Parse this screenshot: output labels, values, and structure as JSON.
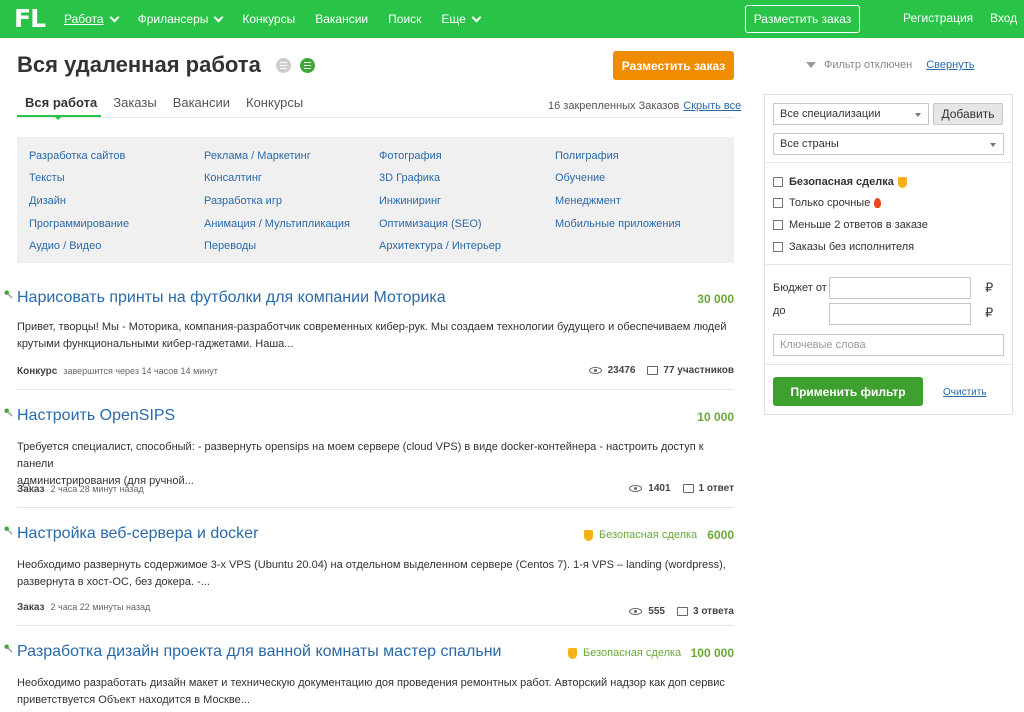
{
  "header": {
    "logo": "FL",
    "nav": [
      {
        "label": "Работа",
        "dropdown": true,
        "active": true
      },
      {
        "label": "Фрилансеры",
        "dropdown": true
      },
      {
        "label": "Конкурсы"
      },
      {
        "label": "Вакансии"
      },
      {
        "label": "Поиск"
      },
      {
        "label": "Еще",
        "dropdown": true
      }
    ],
    "post_order": "Разместить заказ",
    "register": "Регистрация",
    "login": "Вход"
  },
  "page": {
    "title": "Вся удаленная работа",
    "post_order_button": "Разместить заказ",
    "tabs": [
      "Вся работа",
      "Заказы",
      "Вакансии",
      "Конкурсы"
    ],
    "pinned_text": "16 закрепленных Заказов",
    "hide_all": "Скрыть все"
  },
  "categories": [
    [
      "Разработка сайтов",
      "Тексты",
      "Дизайн",
      "Программирование",
      "Аудио / Видео"
    ],
    [
      "Реклама / Маркетинг",
      "Консалтинг",
      "Разработка игр",
      "Анимация / Мультипликация",
      "Переводы"
    ],
    [
      "Фотография",
      "3D Графика",
      "Инжиниринг",
      "Оптимизация (SEO)",
      "Архитектура / Интерьер"
    ],
    [
      "Полиграфия",
      "Обучение",
      "Менеджмент",
      "Мобильные приложения"
    ]
  ],
  "projects": [
    {
      "title": "Нарисовать принты на футболки для компании Моторика",
      "price": "30 000",
      "safe": "",
      "desc1": "Привет, творцы! Мы  -   Моторика, компания-разработчик современных кибер-рук. Мы создаем технологии будущего и обеспечиваем людей",
      "desc2": "крутыми функциональными кибер-гаджетами.   Наша...",
      "type": "Конкурс",
      "time": "завершится через 14 часов 14 минут",
      "views": "23476",
      "replies": "77 участников"
    },
    {
      "title": "Настроить OpenSIPS",
      "price": "10 000",
      "safe": "",
      "desc1": "Требуется специалист, способный: - развернуть opensips на моем сервере (cloud VPS) в виде docker-контейнера - настроить доступ к панели",
      "desc2": "администрирования (для ручной...",
      "type": "Заказ",
      "time": "2 часа 28 минут назад",
      "views": "1401",
      "replies": "1 ответ"
    },
    {
      "title": "Настройка веб-сервера и docker",
      "price": "6000",
      "safe": "Безопасная сделка",
      "desc1": "Необходимо развернуть содержимое 3-х VPS (Ubuntu 20.04) на отдельном выделенном сервере (Centos 7). 1-я VPS – landing (wordpress),",
      "desc2": "развернута в хост-ОС, без докера. -...",
      "type": "Заказ",
      "time": "2 часа 22 минуты назад",
      "views": "555",
      "replies": "3 ответа"
    },
    {
      "title": "Разработка дизайн проекта для ванной комнаты мастер спальни",
      "price": "100 000",
      "safe": "Безопасная сделка",
      "desc1": "Необходимо разработать дизайн макет и техническую документацию доя проведения ремонтных работ. Авторский надзор как доп сервис",
      "desc2": "приветствуется  Объект находится в Москве..."
    }
  ],
  "filter": {
    "status": "Фильтр отключен",
    "collapse": "Свернуть",
    "specialization": "Все специализации",
    "add": "Добавить",
    "countries": "Все страны",
    "checkboxes": [
      "Безопасная сделка",
      "Только срочные",
      "Меньше 2 ответов в заказе",
      "Заказы без исполнителя"
    ],
    "budget_from": "Бюджет от",
    "to": "до",
    "currency": "₽",
    "keywords_placeholder": "Ключевые слова",
    "apply": "Применить фильтр",
    "clear": "Очистить"
  },
  "colors": {
    "brand_green": "#29c347",
    "order_orange": "#f08c00",
    "link_blue": "#2b6aa8",
    "price_green": "#6aa837"
  }
}
